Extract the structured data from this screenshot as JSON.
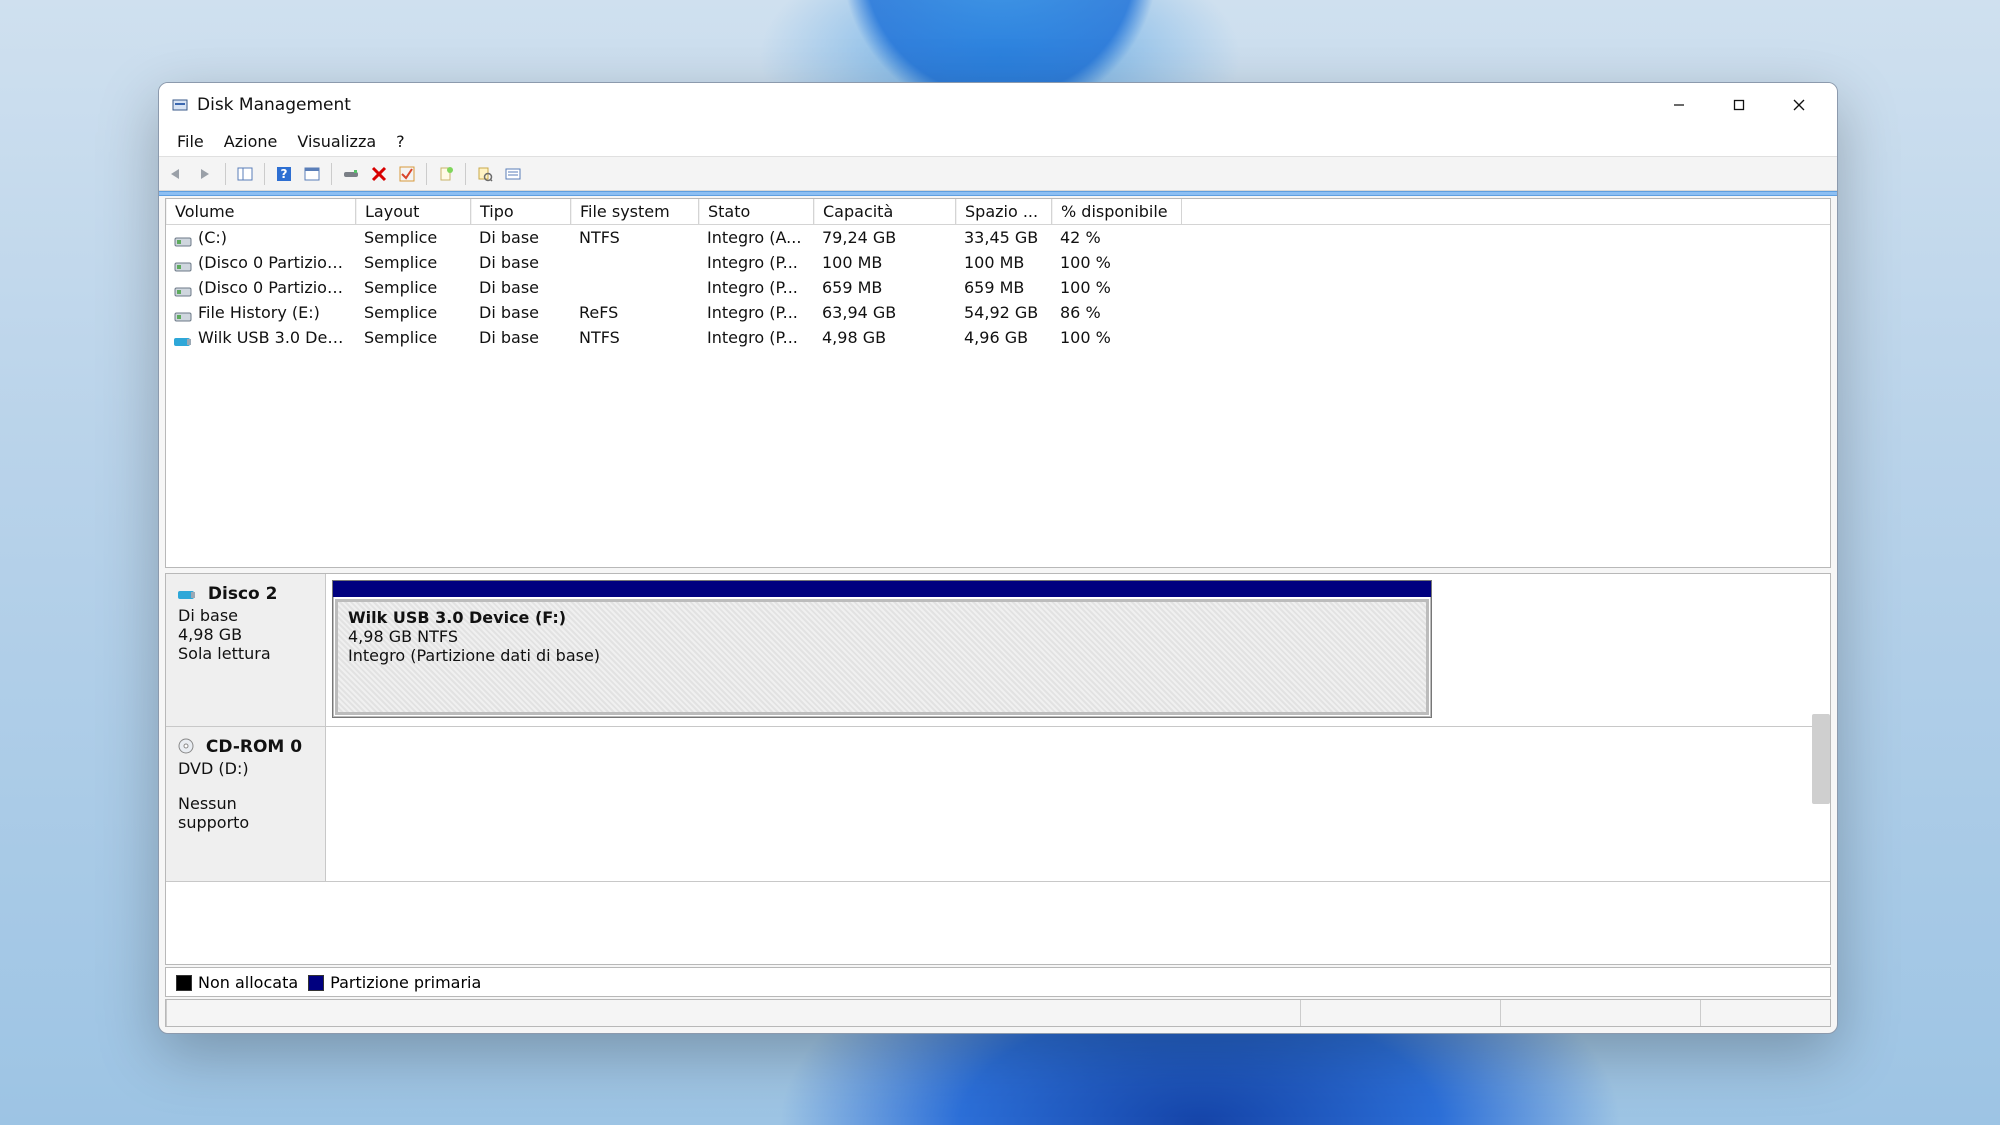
{
  "window": {
    "title": "Disk Management"
  },
  "menu": {
    "file": "File",
    "action": "Azione",
    "view": "Visualizza",
    "help": "?"
  },
  "columns": {
    "volume": "Volume",
    "layout": "Layout",
    "type": "Tipo",
    "fs": "File system",
    "status": "Stato",
    "capacity": "Capacità",
    "free": "Spazio ...",
    "pct": "% disponibile"
  },
  "volumes": [
    {
      "name": "(C:)",
      "layout": "Semplice",
      "type": "Di base",
      "fs": "NTFS",
      "status": "Integro (A...",
      "capacity": "79,24 GB",
      "free": "33,45 GB",
      "pct": "42 %",
      "icon": "hdd"
    },
    {
      "name": "(Disco 0 Partizion...",
      "layout": "Semplice",
      "type": "Di base",
      "fs": "",
      "status": "Integro (P...",
      "capacity": "100 MB",
      "free": "100 MB",
      "pct": "100 %",
      "icon": "hdd"
    },
    {
      "name": "(Disco 0 Partizion...",
      "layout": "Semplice",
      "type": "Di base",
      "fs": "",
      "status": "Integro (P...",
      "capacity": "659 MB",
      "free": "659 MB",
      "pct": "100 %",
      "icon": "hdd"
    },
    {
      "name": "File History (E:)",
      "layout": "Semplice",
      "type": "Di base",
      "fs": "ReFS",
      "status": "Integro (P...",
      "capacity": "63,94 GB",
      "free": "54,92 GB",
      "pct": "86 %",
      "icon": "hdd"
    },
    {
      "name": "Wilk USB 3.0 Devi...",
      "layout": "Semplice",
      "type": "Di base",
      "fs": "NTFS",
      "status": "Integro (P...",
      "capacity": "4,98 GB",
      "free": "4,96 GB",
      "pct": "100 %",
      "icon": "usb"
    }
  ],
  "disk2": {
    "label": "Disco 2",
    "type": "Di base",
    "size": "4,98 GB",
    "mode": "Sola lettura",
    "partition": {
      "name": "Wilk USB 3.0 Device  (F:)",
      "detail": "4,98 GB NTFS",
      "status": "Integro (Partizione dati di base)"
    }
  },
  "cdrom": {
    "label": "CD-ROM 0",
    "line1": "DVD (D:)",
    "line2": "Nessun supporto"
  },
  "legend": {
    "unalloc": "Non allocata",
    "primary": "Partizione primaria"
  }
}
